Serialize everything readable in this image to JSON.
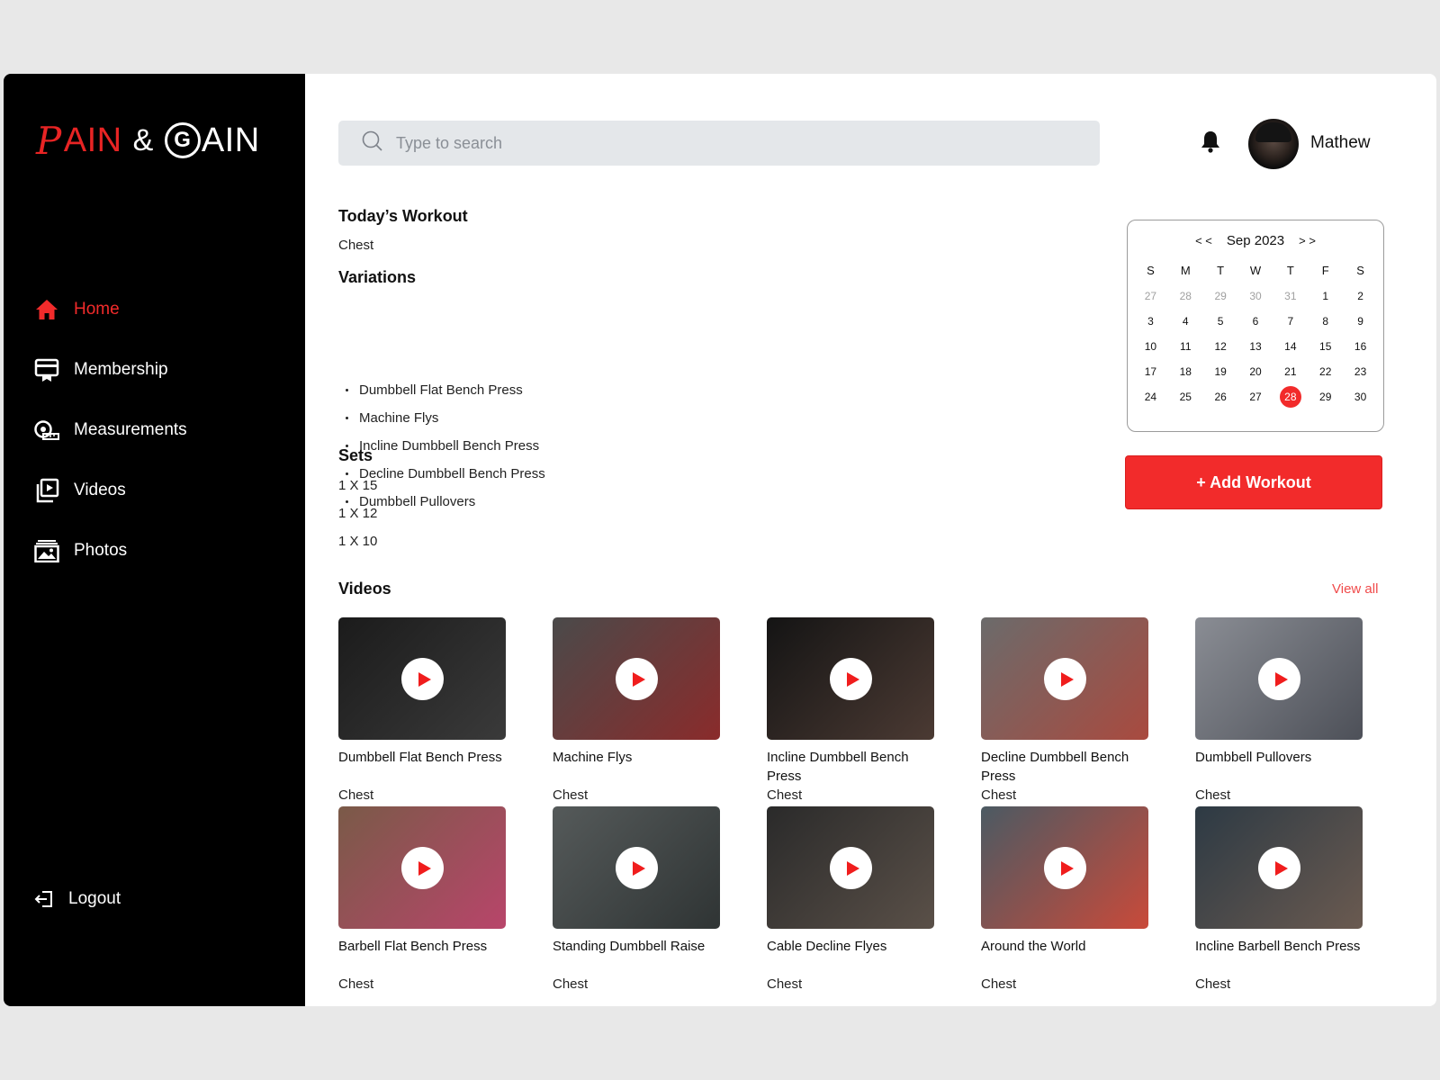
{
  "brand": {
    "p": "P",
    "ain_red": "AIN",
    "amp": "&",
    "g": "G",
    "ain_white": "AIN"
  },
  "colors": {
    "accent": "#f22b2b",
    "sidebar": "#000000",
    "search_bg": "#e4e7ea"
  },
  "nav": {
    "items": [
      {
        "label": "Home",
        "icon": "home-icon",
        "active": true
      },
      {
        "label": "Membership",
        "icon": "membership-card-icon",
        "active": false
      },
      {
        "label": "Measurements",
        "icon": "measuring-tape-icon",
        "active": false
      },
      {
        "label": "Videos",
        "icon": "video-library-icon",
        "active": false
      },
      {
        "label": "Photos",
        "icon": "photo-gallery-icon",
        "active": false
      }
    ],
    "logout": "Logout"
  },
  "search": {
    "placeholder": "Type to search"
  },
  "user": {
    "name": "Mathew"
  },
  "workout": {
    "title": "Today’s Workout",
    "muscle": "Chest",
    "variations_title": "Variations",
    "variations": [
      "Dumbbell Flat Bench Press",
      "Machine Flys",
      "Incline Dumbbell Bench Press",
      "Decline Dumbbell Bench Press",
      "Dumbbell Pullovers"
    ],
    "sets_title": "Sets",
    "sets": [
      "1 X 15",
      "1 X 12",
      "1 X 10"
    ]
  },
  "calendar": {
    "prev": "< <",
    "next": "> >",
    "month": "Sep 2023",
    "weekdays": [
      "S",
      "M",
      "T",
      "W",
      "T",
      "F",
      "S"
    ],
    "days": [
      {
        "d": "27",
        "muted": true
      },
      {
        "d": "28",
        "muted": true
      },
      {
        "d": "29",
        "muted": true
      },
      {
        "d": "30",
        "muted": true
      },
      {
        "d": "31",
        "muted": true
      },
      {
        "d": "1"
      },
      {
        "d": "2"
      },
      {
        "d": "3"
      },
      {
        "d": "4"
      },
      {
        "d": "5"
      },
      {
        "d": "6"
      },
      {
        "d": "7"
      },
      {
        "d": "8"
      },
      {
        "d": "9"
      },
      {
        "d": "10"
      },
      {
        "d": "11"
      },
      {
        "d": "12"
      },
      {
        "d": "13"
      },
      {
        "d": "14"
      },
      {
        "d": "15"
      },
      {
        "d": "16"
      },
      {
        "d": "17"
      },
      {
        "d": "18"
      },
      {
        "d": "19"
      },
      {
        "d": "20"
      },
      {
        "d": "21"
      },
      {
        "d": "22"
      },
      {
        "d": "23"
      },
      {
        "d": "24"
      },
      {
        "d": "25"
      },
      {
        "d": "26"
      },
      {
        "d": "27"
      },
      {
        "d": "28",
        "selected": true
      },
      {
        "d": "29"
      },
      {
        "d": "30"
      }
    ]
  },
  "add_workout": "+ Add Workout",
  "videos": {
    "title": "Videos",
    "view_all": "View all",
    "items": [
      {
        "title": "Dumbbell Flat Bench Press",
        "category": "Chest",
        "tone": [
          "#1b1b1b",
          "#3a3a3a"
        ]
      },
      {
        "title": "Machine Flys",
        "category": "Chest",
        "tone": [
          "#4a4a4a",
          "#8a2b2b"
        ]
      },
      {
        "title": "Incline Dumbbell Bench Press",
        "category": "Chest",
        "tone": [
          "#141414",
          "#4b3a33"
        ]
      },
      {
        "title": "Decline Dumbbell Bench Press",
        "category": "Chest",
        "tone": [
          "#6b6b6b",
          "#a94a3f"
        ]
      },
      {
        "title": "Dumbbell Pullovers",
        "category": "Chest",
        "tone": [
          "#8a8d94",
          "#4d5058"
        ]
      },
      {
        "title": "Barbell Flat Bench Press",
        "category": "Chest",
        "tone": [
          "#7a5a48",
          "#b8456a"
        ]
      },
      {
        "title": "Standing Dumbbell Raise",
        "category": "Chest",
        "tone": [
          "#555a5a",
          "#2f3434"
        ]
      },
      {
        "title": "Cable Decline Flyes",
        "category": "Chest",
        "tone": [
          "#2a2a2a",
          "#5a5048"
        ]
      },
      {
        "title": "Around the World",
        "category": "Chest",
        "tone": [
          "#4b5a63",
          "#c94a3a"
        ]
      },
      {
        "title": "Incline Barbell Bench Press",
        "category": "Chest",
        "tone": [
          "#2d3a44",
          "#6a5a50"
        ]
      }
    ]
  }
}
